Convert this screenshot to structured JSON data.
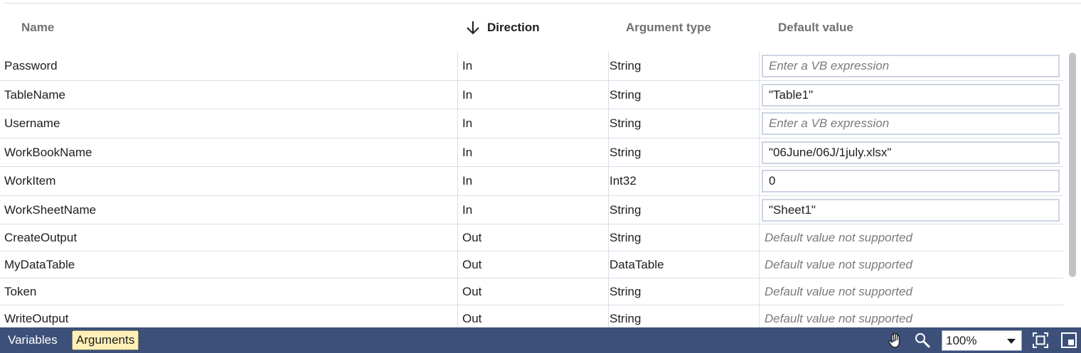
{
  "header": {
    "name": "Name",
    "direction": "Direction",
    "argument_type": "Argument type",
    "default_value": "Default value"
  },
  "rows": [
    {
      "name": "Password",
      "direction": "In",
      "type": "String",
      "default": "",
      "placeholder": "Enter a VB expression"
    },
    {
      "name": "TableName",
      "direction": "In",
      "type": "String",
      "default": "\"Table1\"",
      "placeholder": ""
    },
    {
      "name": "Username",
      "direction": "In",
      "type": "String",
      "default": "",
      "placeholder": "Enter a VB expression"
    },
    {
      "name": "WorkBookName",
      "direction": "In",
      "type": "String",
      "default": "\"06June/06J/1july.xlsx\"",
      "placeholder": ""
    },
    {
      "name": "WorkItem",
      "direction": "In",
      "type": "Int32",
      "default": "0",
      "placeholder": ""
    },
    {
      "name": "WorkSheetName",
      "direction": "In",
      "type": "String",
      "default": "\"Sheet1\"",
      "placeholder": ""
    },
    {
      "name": "CreateOutput",
      "direction": "Out",
      "type": "String",
      "not_supported": "Default value not supported"
    },
    {
      "name": "MyDataTable",
      "direction": "Out",
      "type": "DataTable",
      "not_supported": "Default value not supported"
    },
    {
      "name": "Token",
      "direction": "Out",
      "type": "String",
      "not_supported": "Default value not supported"
    },
    {
      "name": "WriteOutput",
      "direction": "Out",
      "type": "String",
      "not_supported": "Default value not supported"
    }
  ],
  "statusbar": {
    "variables_tab": "Variables",
    "arguments_tab": "Arguments",
    "zoom_value": "100%",
    "icons": [
      "pan-hand-icon",
      "zoom-magnifier-icon",
      "fit-to-screen-icon",
      "overview-icon"
    ]
  },
  "colors": {
    "statusbar_bg": "#3c5079",
    "selected_tab_bg": "#fff0b7",
    "grid_line": "#d9dde6"
  }
}
